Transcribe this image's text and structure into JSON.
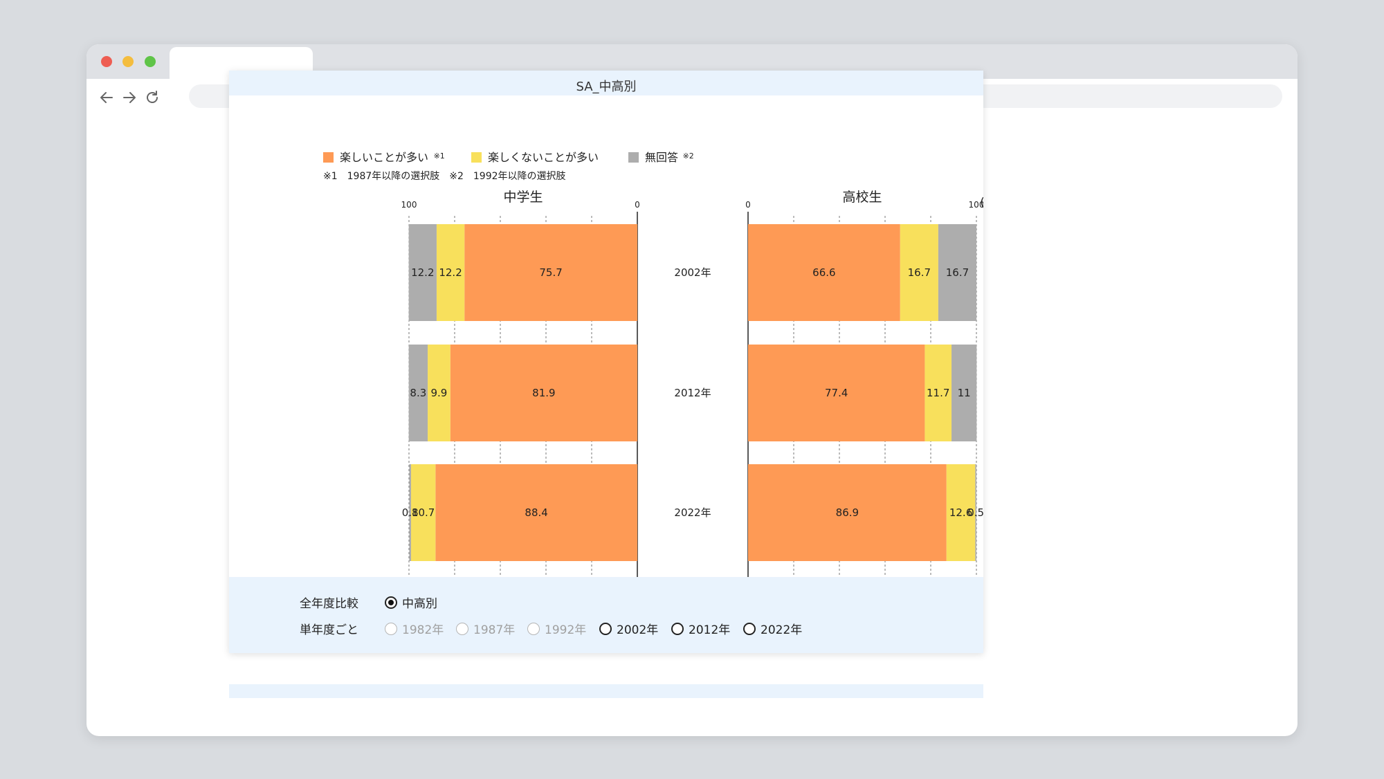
{
  "card": {
    "title": "SA_中高別"
  },
  "legend": {
    "items": [
      {
        "label": "楽しいことが多い",
        "note": "※1",
        "color": "#fe9a55"
      },
      {
        "label": "楽しくないことが多い",
        "note": "",
        "color": "#f8e05c"
      },
      {
        "label": "無回答",
        "note": "※2",
        "color": "#adadad"
      }
    ],
    "footnote": "※1　1987年以降の選択肢　※2　1992年以降の選択肢"
  },
  "chart_data": {
    "type": "bar",
    "orientation": "horizontal-stacked",
    "unit": "(%)",
    "categories": [
      "2002年",
      "2012年",
      "2022年"
    ],
    "panels": [
      {
        "title": "中学生",
        "xlim": [
          100,
          0
        ],
        "tick_labels": [
          "100",
          "0"
        ],
        "series": [
          {
            "name": "楽しいことが多い",
            "values": [
              75.7,
              81.9,
              88.4
            ],
            "labels": [
              "75.7",
              "81.9",
              "88.4"
            ]
          },
          {
            "name": "楽しくないことが多い",
            "values": [
              12.2,
              9.9,
              10.7
            ],
            "labels": [
              "12.2",
              "9.9",
              "10.7"
            ]
          },
          {
            "name": "無回答",
            "values": [
              12.2,
              8.3,
              0.8
            ],
            "labels": [
              "12.2",
              "8.3",
              "0.8"
            ]
          }
        ]
      },
      {
        "title": "高校生",
        "xlim": [
          0,
          100
        ],
        "tick_labels": [
          "0",
          "100"
        ],
        "series": [
          {
            "name": "楽しいことが多い",
            "values": [
              66.6,
              77.4,
              86.9
            ],
            "labels": [
              "66.6",
              "77.4",
              "86.9"
            ]
          },
          {
            "name": "楽しくないことが多い",
            "values": [
              16.7,
              11.7,
              12.6
            ],
            "labels": [
              "16.7",
              "11.7",
              "12.6"
            ]
          },
          {
            "name": "無回答",
            "values": [
              16.7,
              11,
              0.5
            ],
            "labels": [
              "16.7",
              "11",
              "0.5"
            ]
          }
        ]
      }
    ],
    "grid": true,
    "legend_position": "top"
  },
  "controls": {
    "row1": {
      "label": "全年度比較",
      "options": [
        {
          "label": "中高別",
          "checked": true,
          "disabled": false
        }
      ]
    },
    "row2": {
      "label": "単年度ごと",
      "options": [
        {
          "label": "1982年",
          "checked": false,
          "disabled": true
        },
        {
          "label": "1987年",
          "checked": false,
          "disabled": true
        },
        {
          "label": "1992年",
          "checked": false,
          "disabled": true
        },
        {
          "label": "2002年",
          "checked": false,
          "disabled": false
        },
        {
          "label": "2012年",
          "checked": false,
          "disabled": false
        },
        {
          "label": "2022年",
          "checked": false,
          "disabled": false
        }
      ]
    }
  }
}
